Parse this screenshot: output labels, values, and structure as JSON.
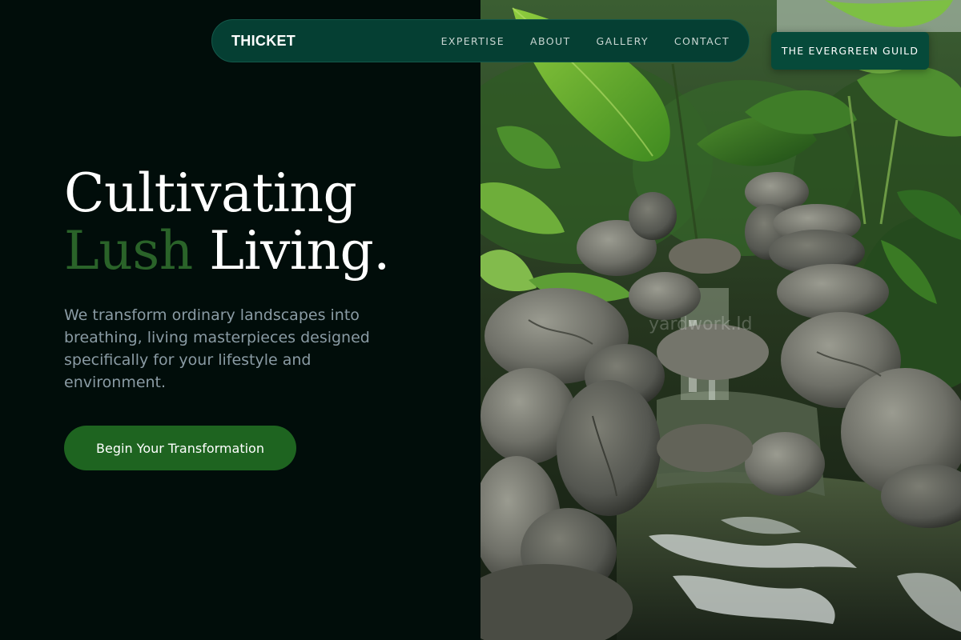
{
  "brand": {
    "name": "THICKET"
  },
  "nav": {
    "links": [
      "EXPERTISE",
      "ABOUT",
      "GALLERY",
      "CONTACT"
    ]
  },
  "guild_button": {
    "label": "THE EVERGREEN GUILD"
  },
  "hero": {
    "title_line1": "Cultivating",
    "title_accent": "Lush",
    "title_rest": "Living.",
    "subtitle": "We transform ordinary landscapes into breathing, living masterpieces designed specifically for your lifestyle and environment.",
    "cta_label": "Begin Your Transformation"
  },
  "scene": {
    "watermark": "yardwork.ld",
    "description_icon": "garden-waterfall-photo"
  },
  "colors": {
    "background": "#010d0a",
    "accent_green": "#2a6329",
    "cta_green": "#1e6420",
    "nav_bg": "#053f33",
    "subtitle_gray": "#8a9ba4"
  }
}
